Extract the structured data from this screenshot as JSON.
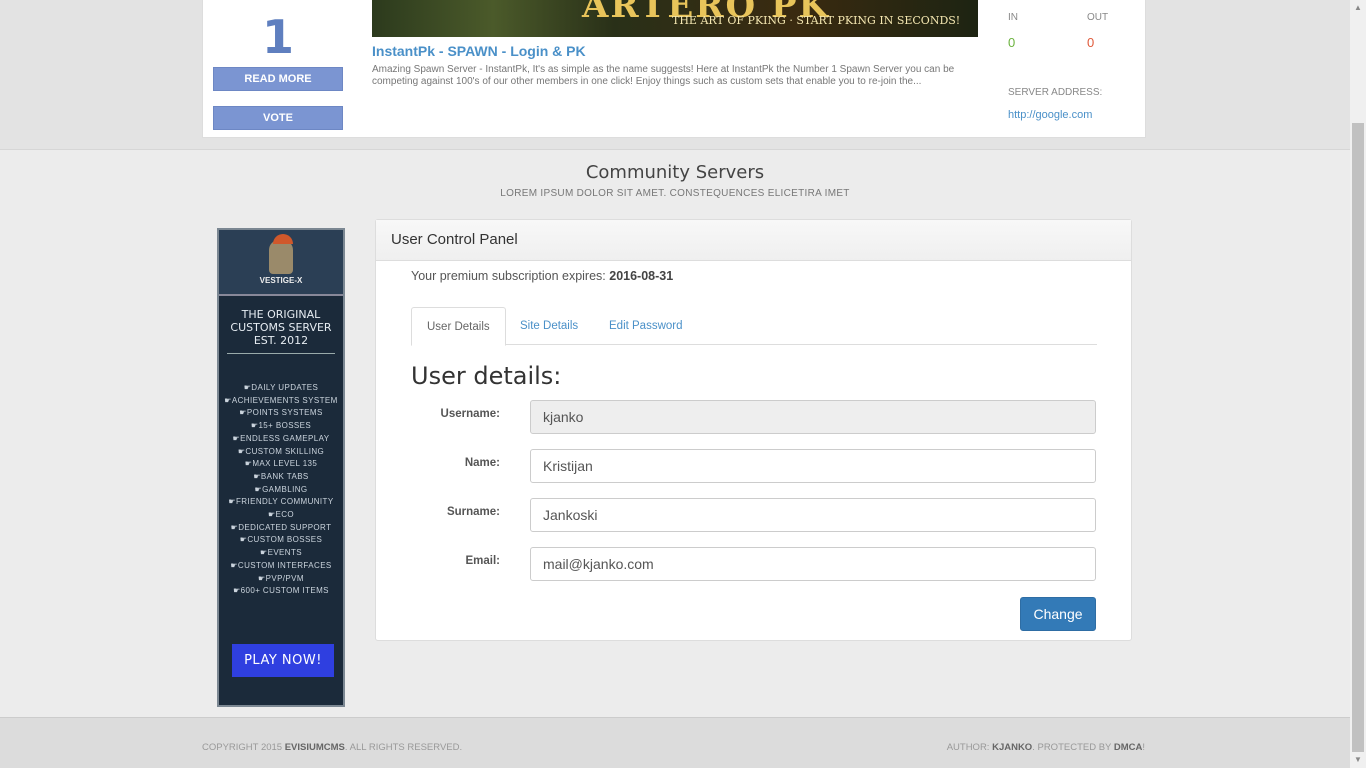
{
  "server_card": {
    "rank": "1",
    "read_more_label": "READ MORE",
    "vote_label": "VOTE",
    "banner_title": "ARTERO PK",
    "banner_subtitle": "THE ART OF PKING · START PKING IN SECONDS!",
    "title": "InstantPk - SPAWN - Login & PK",
    "description": "Amazing Spawn Server - InstantPk, It's as simple as the name suggests! Here at InstantPk the Number 1 Spawn Server you can be competing against 100's of our other members in one click! Enjoy things such as custom sets that enable you to re-join the...",
    "in_label": "IN",
    "out_label": "OUT",
    "in_value": "0",
    "out_value": "0",
    "address_label": "SERVER ADDRESS:",
    "address": "http://google.com"
  },
  "section": {
    "title": "Community Servers",
    "subtitle": "LOREM IPSUM DOLOR SIT AMET. CONSTEQUENCES ELICETIRA IMET"
  },
  "ad": {
    "brand": "VESTIGE-X",
    "headline_1": "THE ORIGINAL",
    "headline_2": "CUSTOMS SERVER",
    "headline_3": "EST. 2012",
    "features": [
      "DAILY UPDATES",
      "ACHIEVEMENTS SYSTEM",
      "POINTS SYSTEMS",
      "15+ BOSSES",
      "ENDLESS GAMEPLAY",
      "CUSTOM SKILLING",
      "MAX LEVEL 135",
      "BANK TABS",
      "GAMBLING",
      "FRIENDLY COMMUNITY",
      "ECO",
      "DEDICATED SUPPORT",
      "CUSTOM BOSSES",
      "EVENTS",
      "CUSTOM INTERFACES",
      "PVP/PVM",
      "600+ CUSTOM ITEMS"
    ],
    "play_label": "PLAY NOW!"
  },
  "panel": {
    "heading": "User Control Panel",
    "premium_prefix": "Your premium subscription expires:",
    "premium_date": "2016-08-31",
    "tabs": [
      {
        "label": "User Details",
        "active": true
      },
      {
        "label": "Site Details",
        "active": false
      },
      {
        "label": "Edit Password",
        "active": false
      }
    ],
    "form_title": "User details:",
    "fields": {
      "username_label": "Username:",
      "username_value": "kjanko",
      "name_label": "Name:",
      "name_value": "Kristijan",
      "surname_label": "Surname:",
      "surname_value": "Jankoski",
      "email_label": "Email:",
      "email_value": "mail@kjanko.com"
    },
    "submit_label": "Change"
  },
  "footer": {
    "copyright_prefix": "COPYRIGHT 2015",
    "brand": "EVISIUMCMS",
    "copyright_suffix": ". ALL RIGHTS RESERVED.",
    "author_prefix": "AUTHOR:",
    "author": "KJANKO",
    "protected_prefix": ". PROTECTED BY",
    "protector": "DMCA",
    "protected_suffix": "!"
  },
  "colors": {
    "accent": "#337ab7",
    "link": "#4a90c8",
    "in_green": "#6cb33f",
    "out_red": "#e05a3a",
    "vote_blue": "#7b95d2"
  }
}
